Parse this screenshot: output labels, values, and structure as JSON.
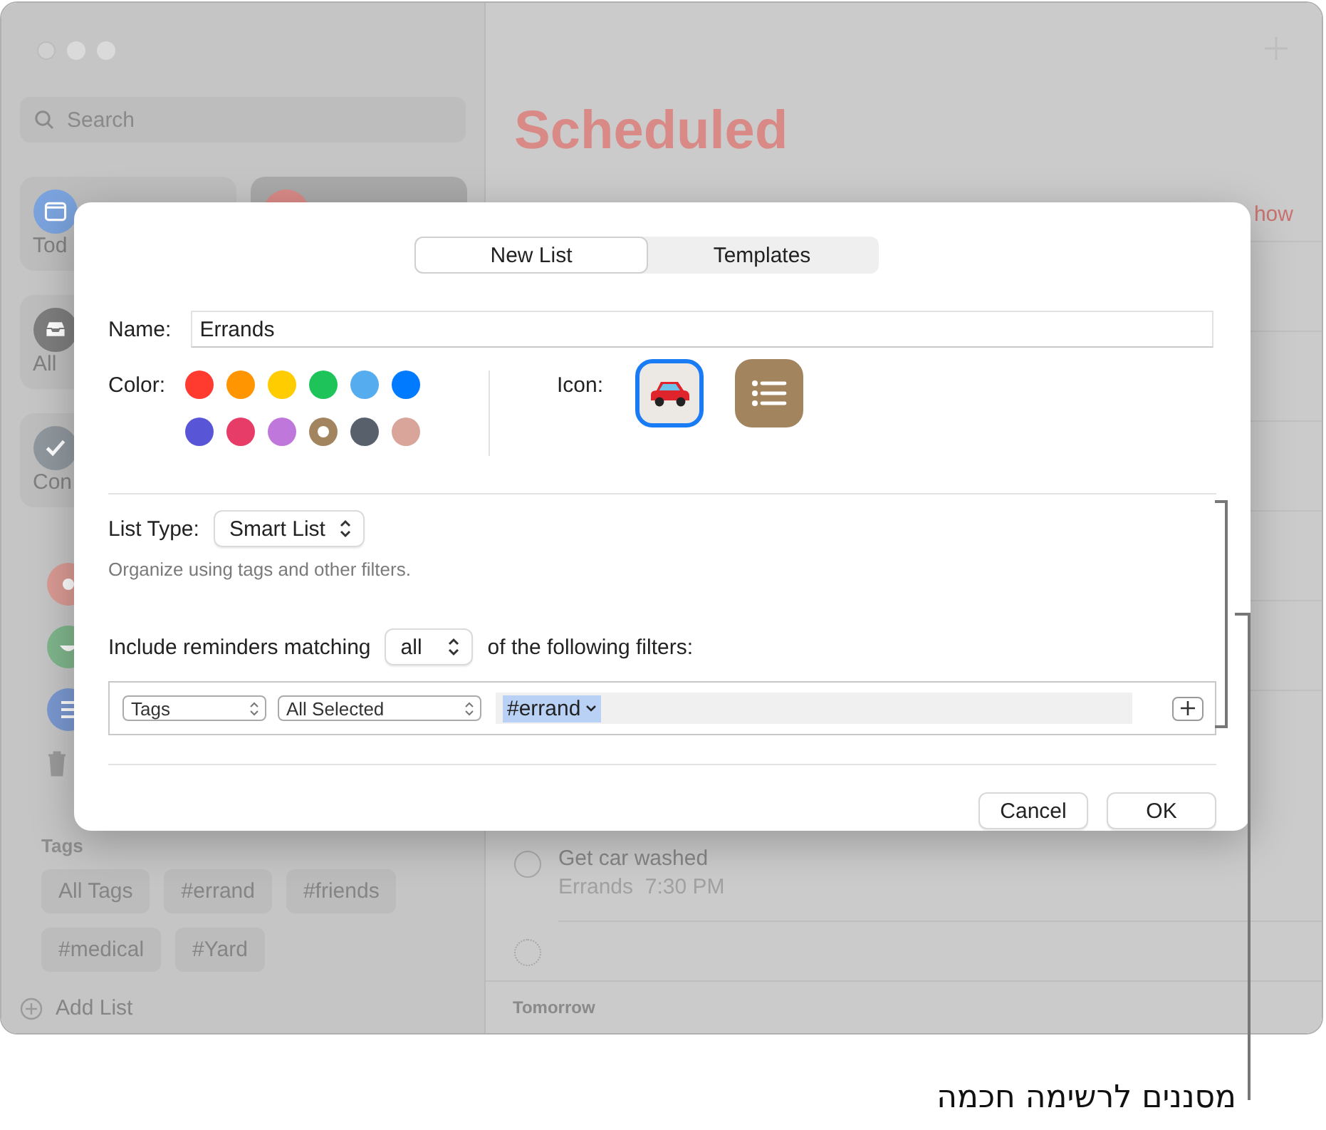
{
  "sidebar": {
    "search": {
      "placeholder": "Search"
    },
    "smart_lists": [
      {
        "kind": "today",
        "label": "Tod",
        "selected": false
      },
      {
        "kind": "scheduled",
        "selected": true
      },
      {
        "kind": "all",
        "label": "All",
        "selected": false
      },
      {
        "kind": "completed",
        "label": "Con",
        "selected": false
      }
    ],
    "lists": [
      {
        "kind": "sun",
        "color": "#d99a93"
      },
      {
        "kind": "bowl",
        "color": "#7fb58b"
      },
      {
        "kind": "list",
        "color": "#7a98d0"
      },
      {
        "kind": "trash",
        "color": "#9a9a9a"
      }
    ],
    "tags": {
      "heading": "Tags",
      "items": [
        "All Tags",
        "#errand",
        "#friends",
        "#medical",
        "#Yard"
      ]
    },
    "add_list": "Add List"
  },
  "main": {
    "title": "Scheduled",
    "show_link": "how",
    "reminders": [
      {
        "kind": "task",
        "title": "Get car washed",
        "list": "Errands",
        "time": "7:30 PM",
        "checked": false
      },
      {
        "kind": "placeholder",
        "checked": false
      }
    ],
    "section": "Tomorrow"
  },
  "dialog": {
    "tabs": [
      {
        "label": "New List",
        "selected": true
      },
      {
        "label": "Templates",
        "selected": false
      }
    ],
    "name_label": "Name:",
    "name": "Errands",
    "color_label": "Color:",
    "colors": [
      {
        "color": "#ff3b30",
        "selected": false
      },
      {
        "color": "#ff9500",
        "selected": false
      },
      {
        "color": "#ffcc00",
        "selected": false
      },
      {
        "color": "#1ec45a",
        "selected": false
      },
      {
        "color": "#55acee",
        "selected": false
      },
      {
        "color": "#007aff",
        "selected": false
      },
      {
        "color": "#5856d6",
        "selected": false
      },
      {
        "color": "#e73c67",
        "selected": false
      },
      {
        "color": "#bf77dc",
        "selected": false
      },
      {
        "color": "#a2845e",
        "selected": true
      },
      {
        "color": "#58616b",
        "selected": false
      },
      {
        "color": "#d9a59b",
        "selected": false
      }
    ],
    "icon_label": "Icon:",
    "icons": [
      {
        "kind": "car",
        "selected": true
      },
      {
        "kind": "list",
        "selected": false
      }
    ],
    "list_type_label": "List Type:",
    "list_type": "Smart List",
    "hint": "Organize using tags and other filters.",
    "match_prefix": "Include reminders matching",
    "match": "all",
    "match_suffix": "of the following filters:",
    "filter": {
      "field": "Tags",
      "operator": "All Selected",
      "token": "#errand"
    },
    "buttons": [
      "Cancel",
      "OK"
    ]
  },
  "caption": "מסננים לרשימה חכמה"
}
